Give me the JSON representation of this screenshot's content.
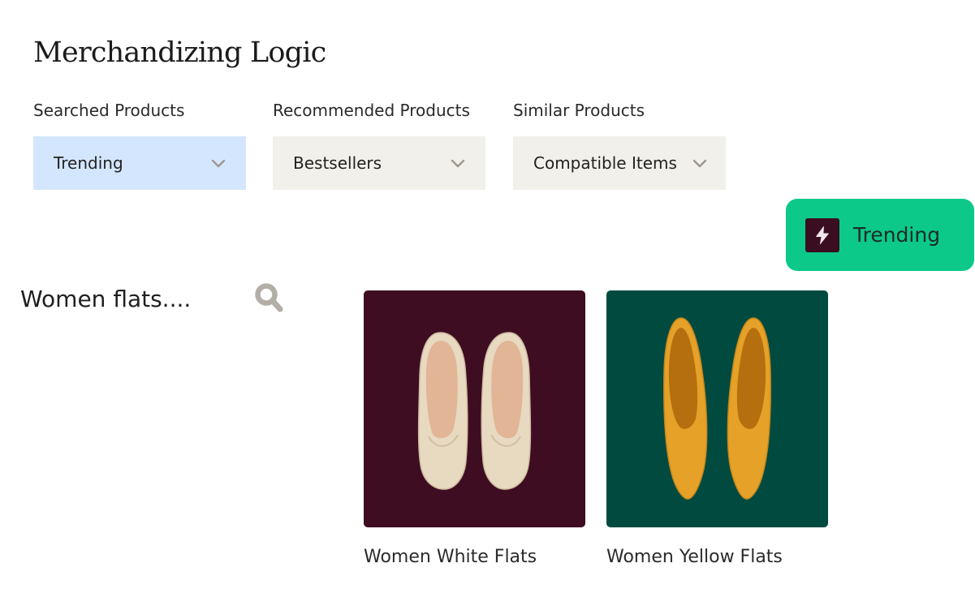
{
  "page": {
    "title": "Merchandizing Logic"
  },
  "filters": [
    {
      "label": "Searched Products",
      "selected": "Trending",
      "active": true
    },
    {
      "label": "Recommended Products",
      "selected": "Bestsellers",
      "active": false
    },
    {
      "label": "Similar Products",
      "selected": "Compatible Items",
      "active": false
    }
  ],
  "badge": {
    "label": "Trending",
    "icon": "lightning-bolt-icon"
  },
  "search": {
    "query": "Women flats....",
    "icon": "search-icon"
  },
  "products": [
    {
      "name": "Women White Flats"
    },
    {
      "name": "Women Yellow Flats"
    }
  ],
  "colors": {
    "active_select_bg": "#d4e6fd",
    "select_bg": "#f2f0ea",
    "chevron": "#9c9890",
    "badge_bg": "#0cc989",
    "badge_icon_bg": "#3a0e20",
    "card_white_bg": "#3e0d22",
    "card_yellow_bg": "#014a40",
    "search_icon": "#b3aea6"
  }
}
